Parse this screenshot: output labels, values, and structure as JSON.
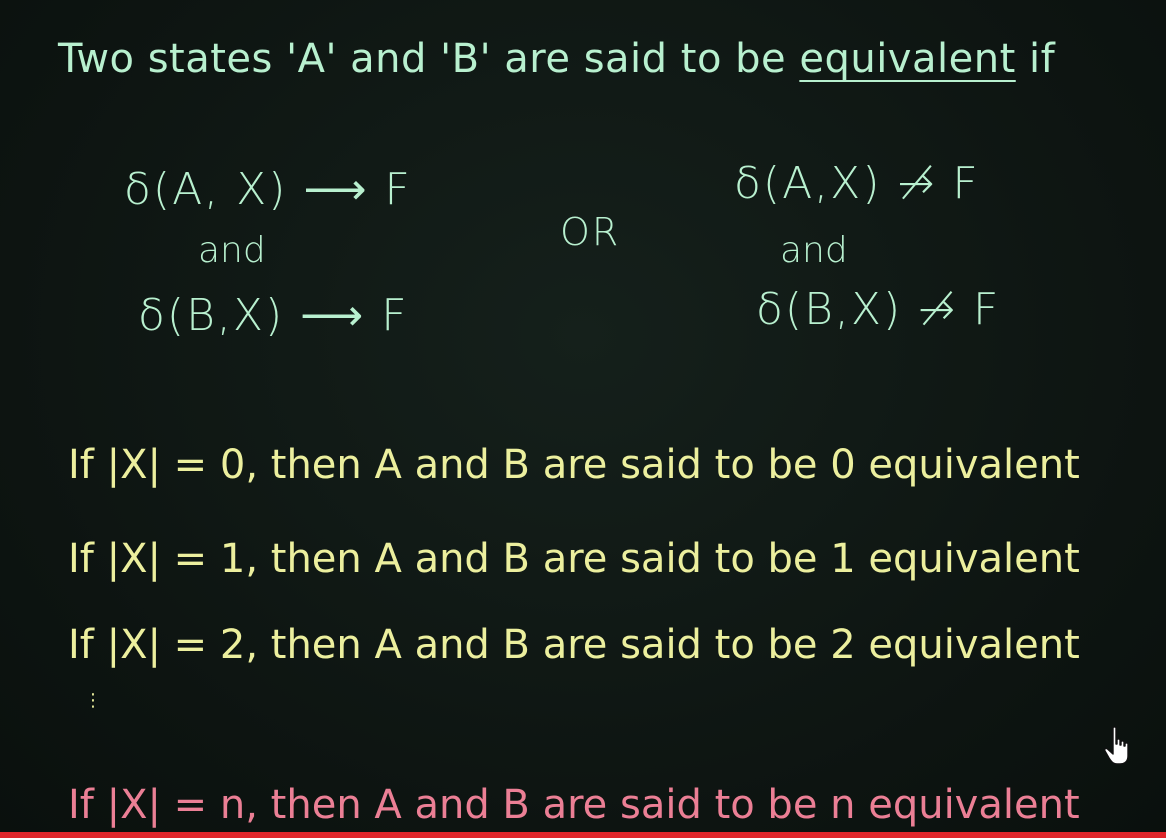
{
  "colors": {
    "background": "#0f1714",
    "green_chalk": "#b8f0cf",
    "yellow_chalk": "#ecef9e",
    "pink_chalk": "#eb7f95",
    "progress_bar": "#e0262b"
  },
  "heading": {
    "prefix": "Two states 'A' and 'B' are said to be ",
    "underlined": "equivalent",
    "suffix": " if"
  },
  "conditions": {
    "left": {
      "line1": "δ(A, X) ⟶ F",
      "conj": "and",
      "line2": "δ(B,X) ⟶ F"
    },
    "or_label": "OR",
    "right": {
      "line1": "δ(A,X) ↛ F",
      "conj": "and",
      "line2": "δ(B,X) ↛ F"
    }
  },
  "rules": [
    "If |X| = 0, then A and B are said to be 0 equivalent",
    "If |X| = 1, then A and B are said to be 1 equivalent",
    "If |X| = 2, then A and B are said to be 2 equivalent"
  ],
  "ellipsis": "⋮",
  "final_rule": "If |X| = n, then A and B are said to be n equivalent",
  "cursor_icon": "hand-pointer-icon"
}
